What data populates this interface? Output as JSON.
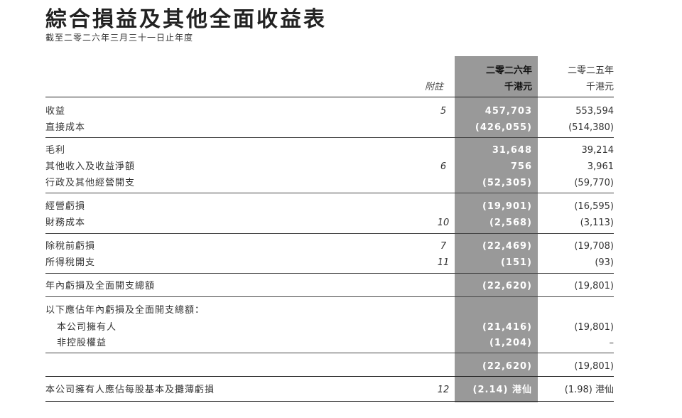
{
  "title": "綜合損益及其他全面收益表",
  "subtitle": "截至二零二六年三月三十一日止年度",
  "header": {
    "note_label": "附註",
    "col_2026_year": "二零二六年",
    "col_2026_unit": "千港元",
    "col_2025_year": "二零二五年",
    "col_2025_unit": "千港元"
  },
  "rows": [
    {
      "label": "收益",
      "note": "5",
      "v2026": "457,703",
      "v2025": "553,594"
    },
    {
      "label": "直接成本",
      "note": "",
      "v2026": "(426,055)",
      "v2025": "(514,380)"
    },
    {
      "label": "毛利",
      "note": "",
      "v2026": "31,648",
      "v2025": "39,214"
    },
    {
      "label": "其他收入及收益淨額",
      "note": "6",
      "v2026": "756",
      "v2025": "3,961"
    },
    {
      "label": "行政及其他經營開支",
      "note": "",
      "v2026": "(52,305)",
      "v2025": "(59,770)"
    },
    {
      "label": "經營虧損",
      "note": "",
      "v2026": "(19,901)",
      "v2025": "(16,595)"
    },
    {
      "label": "財務成本",
      "note": "10",
      "v2026": "(2,568)",
      "v2025": "(3,113)"
    },
    {
      "label": "除稅前虧損",
      "note": "7",
      "v2026": "(22,469)",
      "v2025": "(19,708)"
    },
    {
      "label": "所得稅開支",
      "note": "11",
      "v2026": "(151)",
      "v2025": "(93)"
    },
    {
      "label": "年內虧損及全面開支總額",
      "note": "",
      "v2026": "(22,620)",
      "v2025": "(19,801)"
    },
    {
      "label": "以下應佔年內虧損及全面開支總額：",
      "note": "",
      "v2026": "",
      "v2025": ""
    },
    {
      "label": "本公司擁有人",
      "note": "",
      "v2026": "(21,416)",
      "v2025": "(19,801)"
    },
    {
      "label": "非控股權益",
      "note": "",
      "v2026": "(1,204)",
      "v2025": "–"
    },
    {
      "label": "",
      "note": "",
      "v2026": "(22,620)",
      "v2025": "(19,801)"
    },
    {
      "label": "本公司擁有人應佔每股基本及攤薄虧損",
      "note": "12",
      "v2026": "(2.14) 港仙",
      "v2025": "(1.98) 港仙"
    }
  ]
}
